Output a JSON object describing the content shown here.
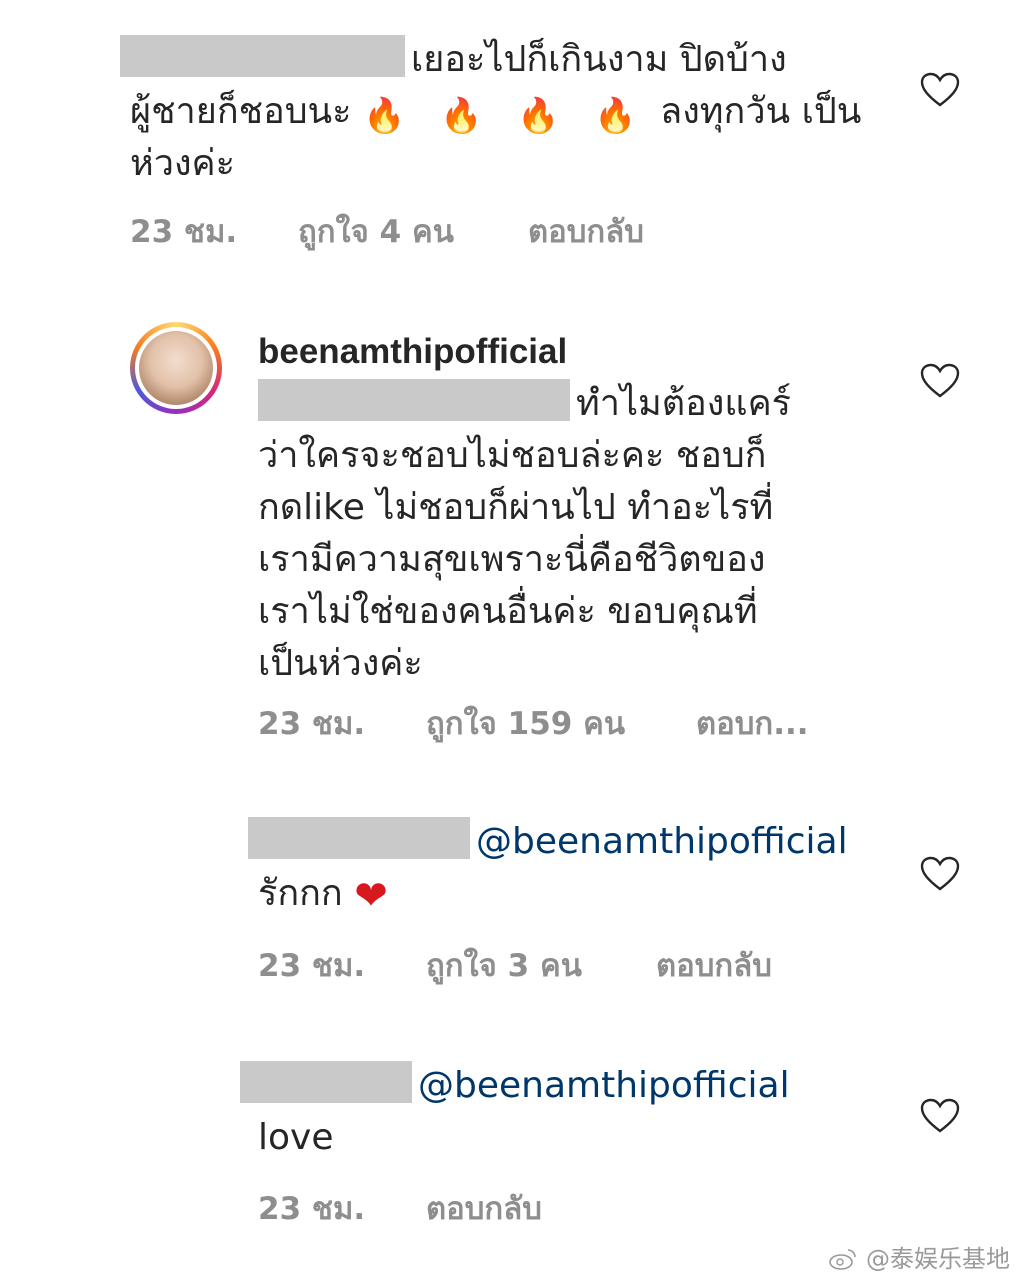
{
  "comments": [
    {
      "text_lines": [
        "เยอะไปก็เกินงาม ปิดบ้าง",
        "ผู้ชายก็ชอบนะ",
        "ลงทุกวัน เป็น",
        "ห่วงค่ะ"
      ],
      "emoji": "🔥 🔥 🔥 🔥",
      "time": "23 ชม.",
      "likes": "ถูกใจ 4 คน",
      "reply": "ตอบกลับ"
    },
    {
      "username": "beenamthipofficial",
      "text_lines": [
        "ทำไมต้องแคร์",
        "ว่าใครจะชอบไม่ชอบล่ะคะ ชอบก็",
        "กดlike ไม่ชอบก็ผ่านไป ทำอะไรที่",
        "เรามีความสุขเพราะนี่คือชีวิตของ",
        "เราไม่ใช่ของคนอื่นค่ะ ขอบคุณที่",
        "เป็นห่วงค่ะ"
      ],
      "time": "23 ชม.",
      "likes": "ถูกใจ 159 คน",
      "reply": "ตอบก..."
    },
    {
      "mention": "@beenamthipofficial",
      "text": "รักกก",
      "emoji": "❤",
      "time": "23 ชม.",
      "likes": "ถูกใจ 3 คน",
      "reply": "ตอบกลับ"
    },
    {
      "mention": "@beenamthipofficial",
      "text": "love",
      "time": "23 ชม.",
      "reply": "ตอบกลับ"
    }
  ],
  "icons": {
    "like": "heart-outline-icon",
    "avatar": "user-avatar",
    "watermark_logo": "weibo-icon"
  },
  "watermark": "@泰娱乐基地",
  "colors": {
    "text": "#262626",
    "meta": "#8e8e8e",
    "mention": "#00376b",
    "redaction": "#c9c9c9"
  }
}
